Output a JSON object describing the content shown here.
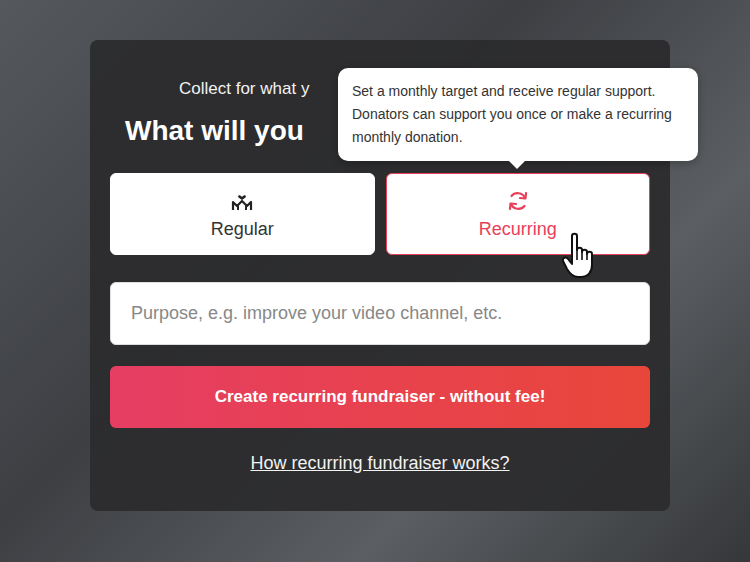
{
  "header": {
    "subtitle": "Collect for what y",
    "title": "What will you"
  },
  "tooltip": {
    "text": "Set a monthly target and receive regular support. Donators can support you once or make a recurring monthly donation."
  },
  "types": [
    {
      "label": "Regular",
      "kind": "regular",
      "selected": false
    },
    {
      "label": "Recurring",
      "kind": "recurring",
      "selected": true
    }
  ],
  "purpose": {
    "placeholder": "Purpose, e.g. improve your video channel, etc."
  },
  "submit": "Create recurring fundraiser - without fee!",
  "link": "How recurring fundraiser works?"
}
